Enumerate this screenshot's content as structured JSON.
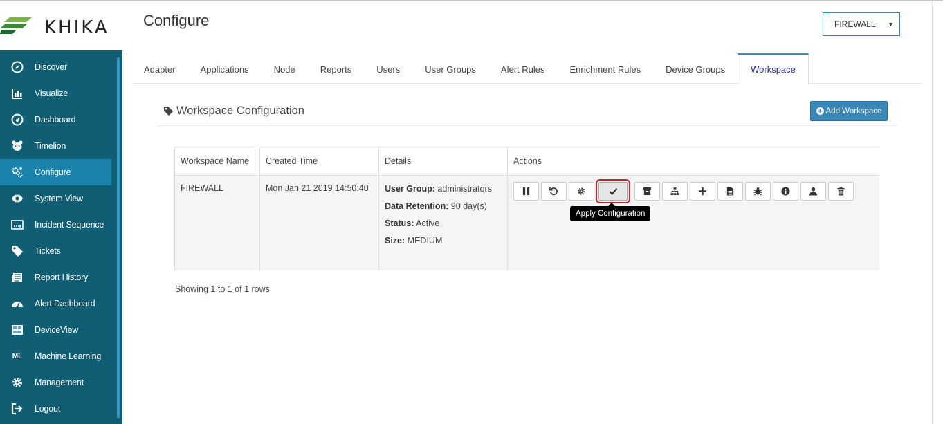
{
  "logo": {
    "text": "KHIKA"
  },
  "sidebar": {
    "items": [
      {
        "label": "Discover",
        "icon": "compass-icon"
      },
      {
        "label": "Visualize",
        "icon": "bar-chart-icon"
      },
      {
        "label": "Dashboard",
        "icon": "dashboard-icon"
      },
      {
        "label": "Timelion",
        "icon": "bear-icon"
      },
      {
        "label": "Configure",
        "icon": "cogs-icon",
        "active": true
      },
      {
        "label": "System View",
        "icon": "eye-icon"
      },
      {
        "label": "Incident Sequence",
        "icon": "sequence-icon"
      },
      {
        "label": "Tickets",
        "icon": "tag-icon"
      },
      {
        "label": "Report History",
        "icon": "newspaper-icon"
      },
      {
        "label": "Alert Dashboard",
        "icon": "gauge-icon"
      },
      {
        "label": "DeviceView",
        "icon": "device-icon"
      },
      {
        "label": "Machine Learning",
        "icon": "ml-text-icon",
        "glyph": "ML"
      },
      {
        "label": "Management",
        "icon": "gear-icon"
      },
      {
        "label": "Logout",
        "icon": "logout-icon"
      }
    ]
  },
  "header": {
    "title": "Configure",
    "workspace_select": "FIREWALL"
  },
  "tabs": [
    "Adapter",
    "Applications",
    "Node",
    "Reports",
    "Users",
    "User Groups",
    "Alert Rules",
    "Enrichment Rules",
    "Device Groups",
    "Workspace"
  ],
  "active_tab": "Workspace",
  "section": {
    "title": "Workspace Configuration",
    "add_button": "Add Workspace"
  },
  "table": {
    "headers": [
      "Workspace Name",
      "Created Time",
      "Details",
      "Actions"
    ],
    "row": {
      "name": "FIREWALL",
      "created": "Mon Jan 21 2019 14:50:40",
      "details": [
        {
          "label": "User Group:",
          "value": " administrators"
        },
        {
          "label": "Data Retention:",
          "value": " 90 day(s)"
        },
        {
          "label": "Status:",
          "value": " Active"
        },
        {
          "label": "Size:",
          "value": " MEDIUM"
        }
      ]
    }
  },
  "actions": [
    "pause-icon",
    "refresh-icon",
    "gear-icon",
    "check-icon",
    "archive-icon",
    "sitemap-icon",
    "plus-icon",
    "file-icon",
    "bug-icon",
    "info-icon",
    "user-icon",
    "trash-icon"
  ],
  "tooltip": "Apply Configuration",
  "pager": "Showing 1 to 1 of 1 rows",
  "colors": {
    "sidebar": "#0f5e74",
    "active_nav": "#1a84ad",
    "accent": "#3a88b8",
    "highlight": "#d0202a"
  }
}
